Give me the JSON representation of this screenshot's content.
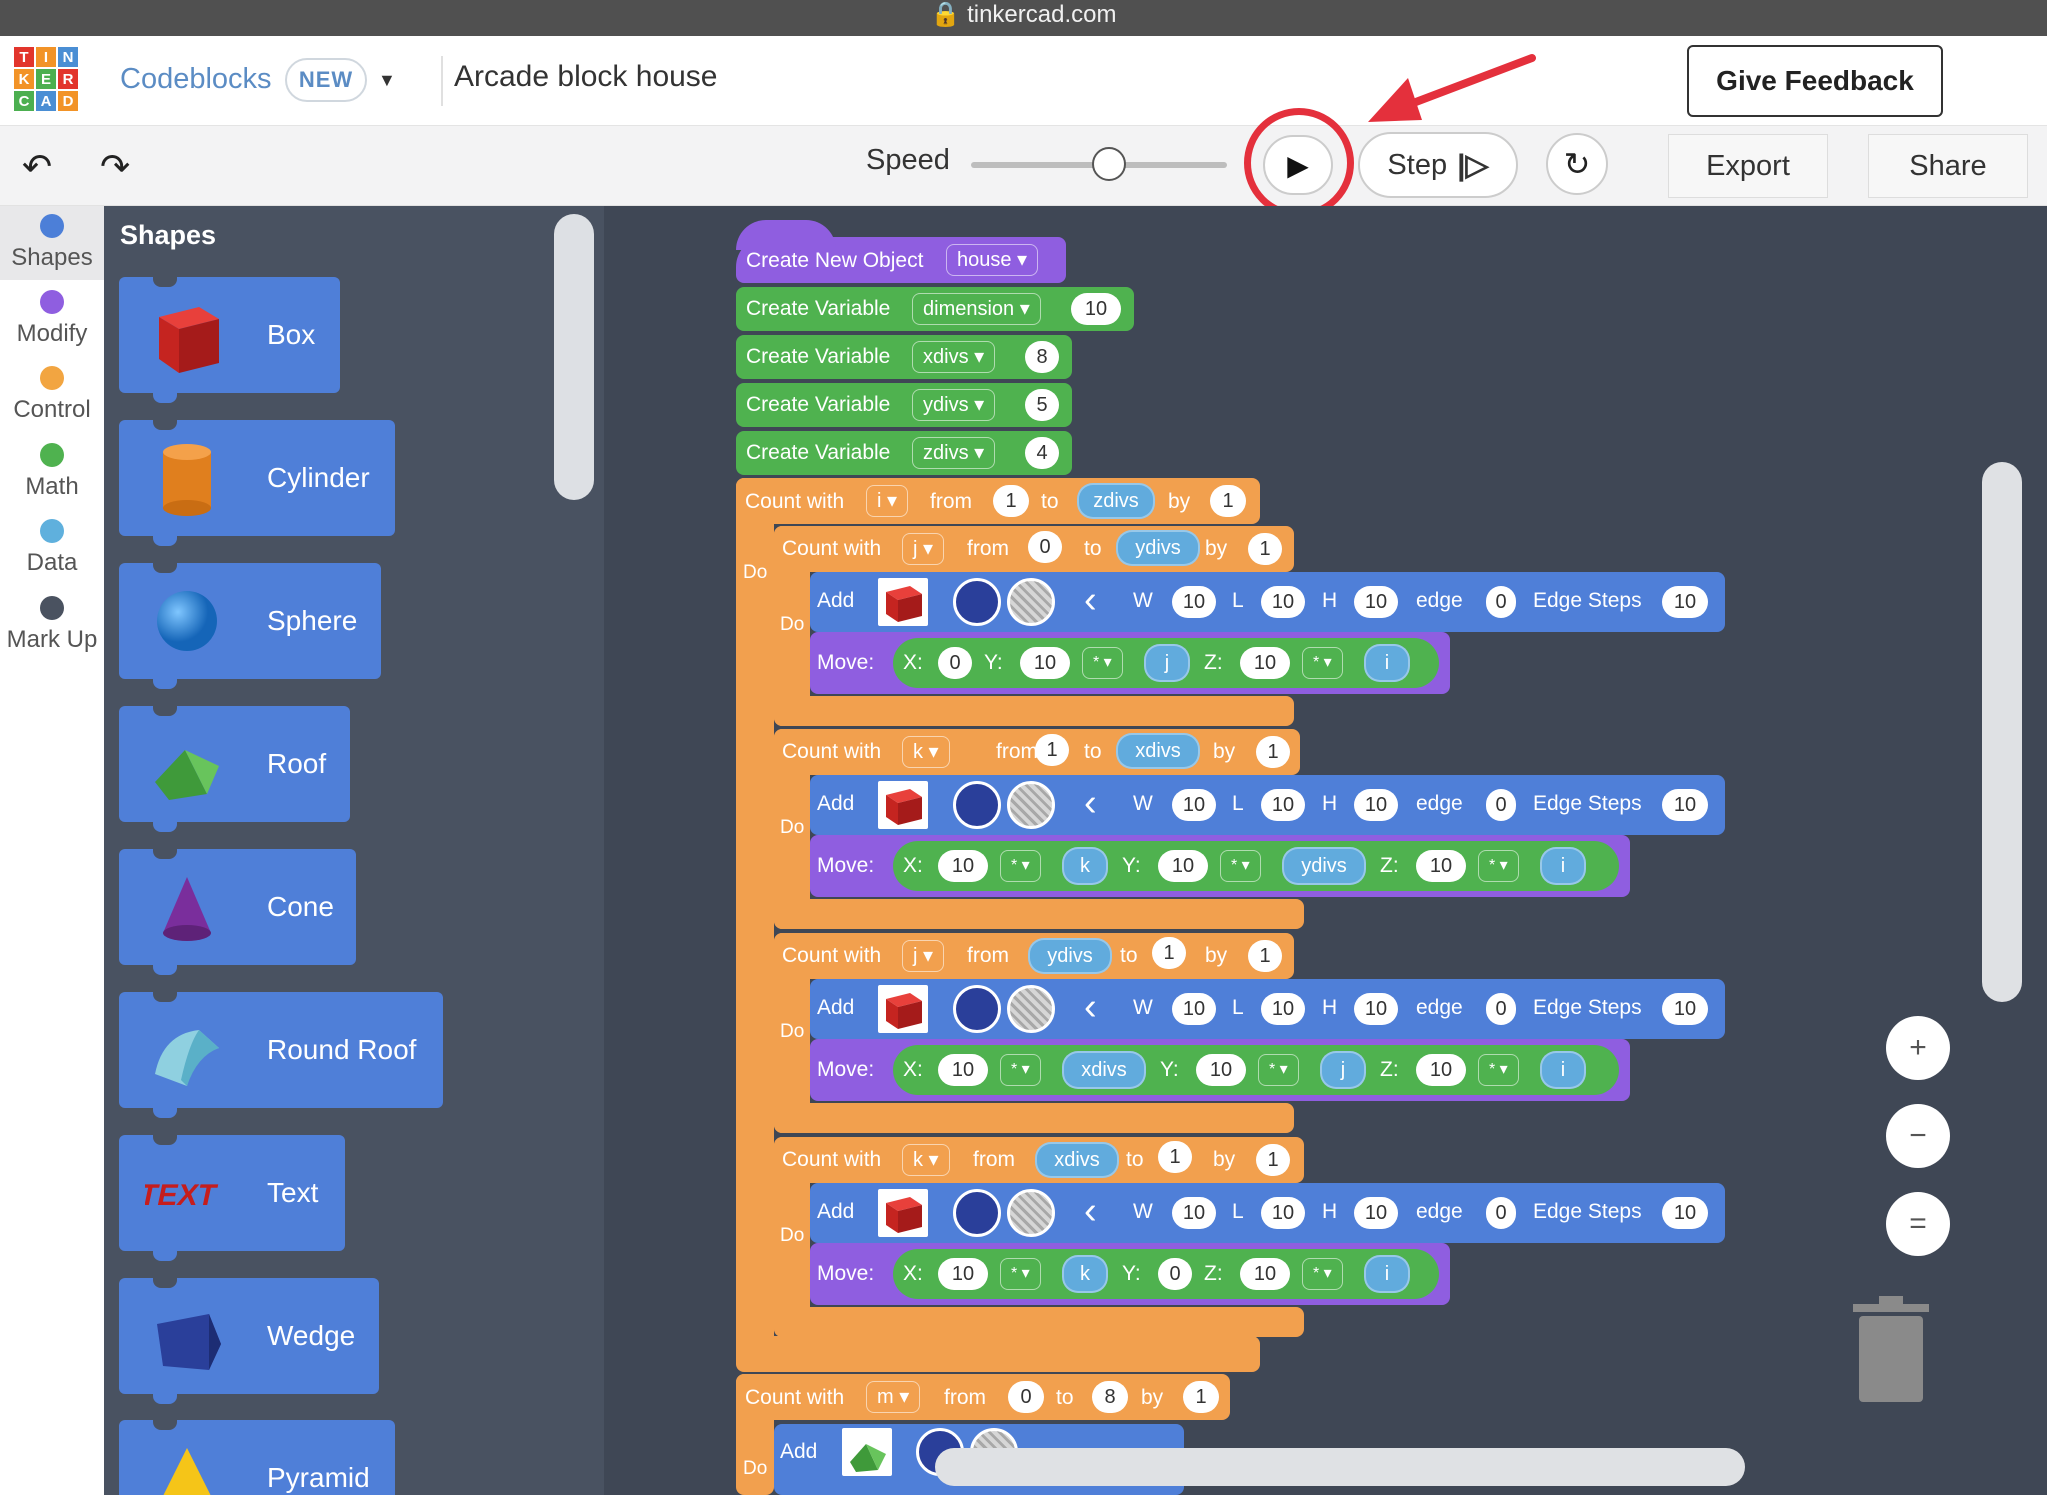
{
  "browser": {
    "url": "tinkercad.com"
  },
  "logo": {
    "letters": [
      "T",
      "I",
      "N",
      "K",
      "E",
      "R",
      "C",
      "A",
      "D"
    ]
  },
  "header": {
    "mode_label": "Codeblocks",
    "new_badge": "NEW",
    "dropdown_glyph": "▼",
    "project_title": "Arcade block house",
    "feedback_label": "Give Feedback"
  },
  "toolbar": {
    "undo_glyph": "↶",
    "redo_glyph": "↷",
    "speed_label": "Speed",
    "speed_level": 0.5,
    "play_glyph": "▶",
    "step_label": "Step",
    "step_glyph": "⏵",
    "reset_glyph": "↻",
    "export_label": "Export",
    "share_label": "Share"
  },
  "categories": [
    {
      "label": "Shapes",
      "color": "#4c7fd8"
    },
    {
      "label": "Modify",
      "color": "#8f5ee0"
    },
    {
      "label": "Control",
      "color": "#f2a541"
    },
    {
      "label": "Math",
      "color": "#4fb24f"
    },
    {
      "label": "Data",
      "color": "#5fb0dd"
    },
    {
      "label": "Mark Up",
      "color": "#4a5260"
    }
  ],
  "flyout": {
    "title": "Shapes",
    "items": [
      {
        "label": "Box",
        "icon": "box-icon"
      },
      {
        "label": "Cylinder",
        "icon": "cylinder-icon"
      },
      {
        "label": "Sphere",
        "icon": "sphere-icon"
      },
      {
        "label": "Roof",
        "icon": "roof-icon"
      },
      {
        "label": "Cone",
        "icon": "cone-icon"
      },
      {
        "label": "Round Roof",
        "icon": "round-roof-icon"
      },
      {
        "label": "Text",
        "icon": "text-icon"
      },
      {
        "label": "Wedge",
        "icon": "wedge-icon"
      },
      {
        "label": "Pyramid",
        "icon": "pyramid-icon"
      }
    ]
  },
  "code": {
    "create_object": {
      "label": "Create New Object",
      "name": "house"
    },
    "variables": [
      {
        "label": "Create Variable",
        "name": "dimension",
        "value": "10"
      },
      {
        "label": "Create Variable",
        "name": "xdivs",
        "value": "8"
      },
      {
        "label": "Create Variable",
        "name": "ydivs",
        "value": "5"
      },
      {
        "label": "Create Variable",
        "name": "zdivs",
        "value": "4"
      }
    ],
    "kw": {
      "count_with": "Count with",
      "from": "from",
      "to": "to",
      "by": "by",
      "do": "Do",
      "add": "Add",
      "move": "Move:",
      "x": "X:",
      "y": "Y:",
      "z": "Z:",
      "w": "W",
      "l": "L",
      "h": "H",
      "edge": "edge",
      "edge_steps": "Edge Steps",
      "op": "* ▾"
    },
    "outer_loop": {
      "var": "i",
      "from": "1",
      "to": "zdivs",
      "by": "1"
    },
    "loops": [
      {
        "var": "j",
        "from": "0",
        "to": "ydivs",
        "by": "1",
        "add": {
          "w": "10",
          "l": "10",
          "h": "10",
          "edge": "0",
          "edge_steps": "10"
        },
        "move": {
          "x": "0",
          "y_num": "10",
          "y_var": "j",
          "z_num": "10",
          "z_var": "i"
        }
      },
      {
        "var": "k",
        "from": "1",
        "to": "xdivs",
        "by": "1",
        "add": {
          "w": "10",
          "l": "10",
          "h": "10",
          "edge": "0",
          "edge_steps": "10"
        },
        "move": {
          "x_num": "10",
          "x_var": "k",
          "y_num": "10",
          "y_var": "ydivs",
          "z_num": "10",
          "z_var": "i"
        }
      },
      {
        "var": "j",
        "from": "ydivs",
        "to": "1",
        "by": "1",
        "add": {
          "w": "10",
          "l": "10",
          "h": "10",
          "edge": "0",
          "edge_steps": "10"
        },
        "move": {
          "x_num": "10",
          "x_var": "xdivs",
          "y_num": "10",
          "y_var": "j",
          "z_num": "10",
          "z_var": "i"
        }
      },
      {
        "var": "k",
        "from": "xdivs",
        "to": "1",
        "by": "1",
        "add": {
          "w": "10",
          "l": "10",
          "h": "10",
          "edge": "0",
          "edge_steps": "10"
        },
        "move": {
          "x_num": "10",
          "x_var": "k",
          "y": "0",
          "z_num": "10",
          "z_var": "i"
        }
      }
    ],
    "last_loop": {
      "var": "m",
      "from": "0",
      "to": "8",
      "by": "1"
    }
  },
  "zoom": {
    "in": "+",
    "out": "−",
    "reset": "="
  }
}
